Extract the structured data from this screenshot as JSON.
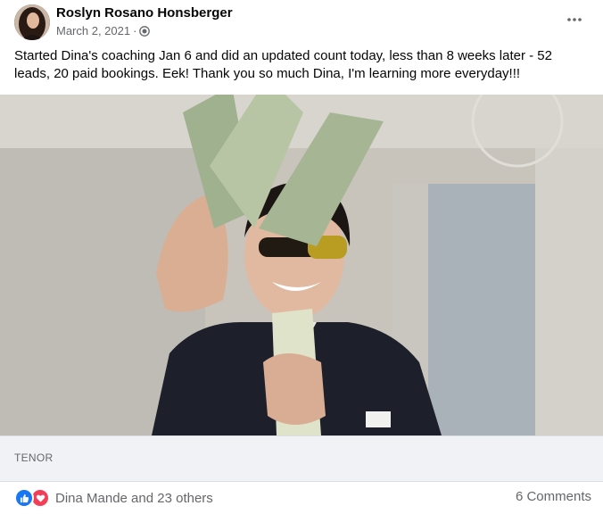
{
  "post": {
    "author": "Roslyn Rosano Honsberger",
    "date": "March 2, 2021",
    "privacy_icon": "globe-icon",
    "more_icon": "more-options-icon",
    "body": "Started Dina's coaching Jan 6 and did an updated count today, less than 8 weeks later - 52 leads, 20 paid bookings. Eek!  Thank you so much Dina, I'm learning more everyday!!!"
  },
  "attachment": {
    "source_label": "TENOR"
  },
  "footer": {
    "reactions_text": "Dina Mande and 23 others",
    "reaction_icons": [
      "like-icon",
      "love-icon"
    ],
    "comments_text": "6 Comments"
  },
  "colors": {
    "like": "#1877f2",
    "love": "#f33e58",
    "secondary_text": "#65676b"
  }
}
